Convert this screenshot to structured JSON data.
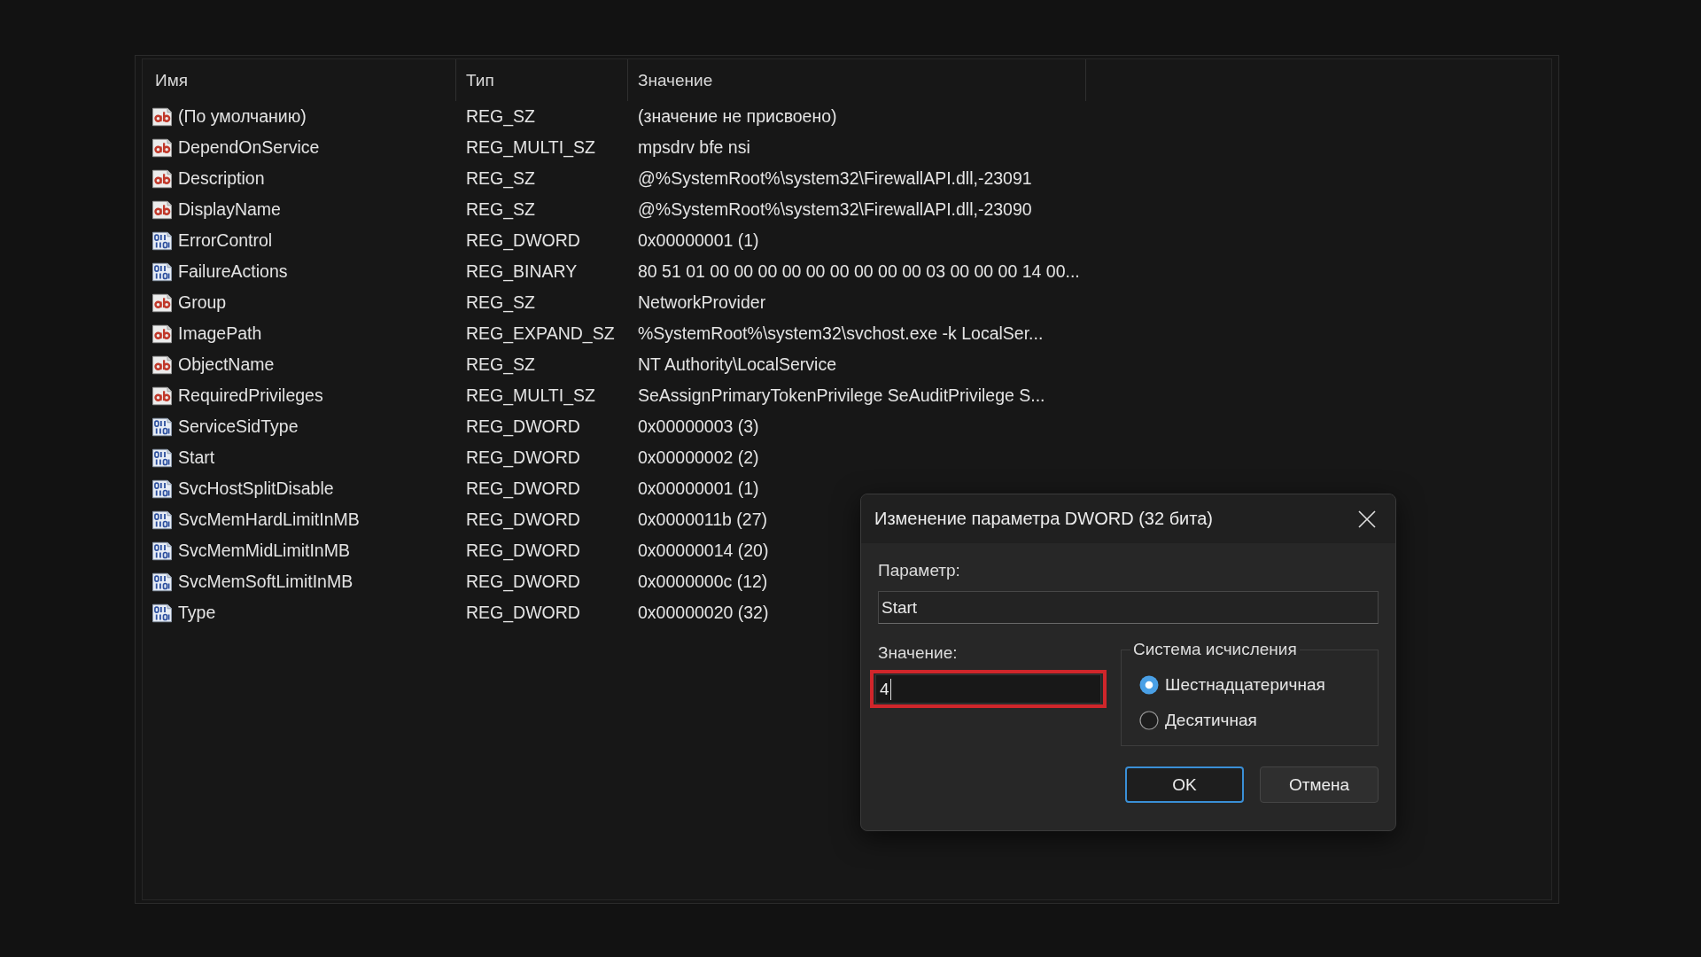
{
  "list": {
    "columns": [
      "Имя",
      "Тип",
      "Значение"
    ],
    "rows": [
      {
        "kind": "string",
        "name": "(По умолчанию)",
        "type": "REG_SZ",
        "value": "(значение не присвоено)"
      },
      {
        "kind": "string",
        "name": "DependOnService",
        "type": "REG_MULTI_SZ",
        "value": "mpsdrv bfe nsi"
      },
      {
        "kind": "string",
        "name": "Description",
        "type": "REG_SZ",
        "value": "@%SystemRoot%\\system32\\FirewallAPI.dll,-23091"
      },
      {
        "kind": "string",
        "name": "DisplayName",
        "type": "REG_SZ",
        "value": "@%SystemRoot%\\system32\\FirewallAPI.dll,-23090"
      },
      {
        "kind": "binary",
        "name": "ErrorControl",
        "type": "REG_DWORD",
        "value": "0x00000001 (1)"
      },
      {
        "kind": "binary",
        "name": "FailureActions",
        "type": "REG_BINARY",
        "value": "80 51 01 00 00 00 00 00 00 00 00 00 03 00 00 00 14 00..."
      },
      {
        "kind": "string",
        "name": "Group",
        "type": "REG_SZ",
        "value": "NetworkProvider"
      },
      {
        "kind": "string",
        "name": "ImagePath",
        "type": "REG_EXPAND_SZ",
        "value": "%SystemRoot%\\system32\\svchost.exe -k LocalSer..."
      },
      {
        "kind": "string",
        "name": "ObjectName",
        "type": "REG_SZ",
        "value": "NT Authority\\LocalService"
      },
      {
        "kind": "string",
        "name": "RequiredPrivileges",
        "type": "REG_MULTI_SZ",
        "value": "SeAssignPrimaryTokenPrivilege SeAuditPrivilege S..."
      },
      {
        "kind": "binary",
        "name": "ServiceSidType",
        "type": "REG_DWORD",
        "value": "0x00000003 (3)"
      },
      {
        "kind": "binary",
        "name": "Start",
        "type": "REG_DWORD",
        "value": "0x00000002 (2)"
      },
      {
        "kind": "binary",
        "name": "SvcHostSplitDisable",
        "type": "REG_DWORD",
        "value": "0x00000001 (1)"
      },
      {
        "kind": "binary",
        "name": "SvcMemHardLimitInMB",
        "type": "REG_DWORD",
        "value": "0x0000011b (27)"
      },
      {
        "kind": "binary",
        "name": "SvcMemMidLimitInMB",
        "type": "REG_DWORD",
        "value": "0x00000014 (20)"
      },
      {
        "kind": "binary",
        "name": "SvcMemSoftLimitInMB",
        "type": "REG_DWORD",
        "value": "0x0000000c (12)"
      },
      {
        "kind": "binary",
        "name": "Type",
        "type": "REG_DWORD",
        "value": "0x00000020 (32)"
      }
    ]
  },
  "dialog": {
    "title": "Изменение параметра DWORD (32 бита)",
    "parameter_label": "Параметр:",
    "parameter_value": "Start",
    "value_label": "Значение:",
    "value": "4",
    "value_focused": true,
    "value_highlighted": true,
    "base_group": {
      "label": "Система исчисления",
      "options": [
        {
          "label": "Шестнадцатеричная",
          "selected": true
        },
        {
          "label": "Десятичная",
          "selected": false
        }
      ]
    },
    "buttons": [
      {
        "label": "OK",
        "default": true
      },
      {
        "label": "Отмена",
        "default": false
      }
    ]
  }
}
